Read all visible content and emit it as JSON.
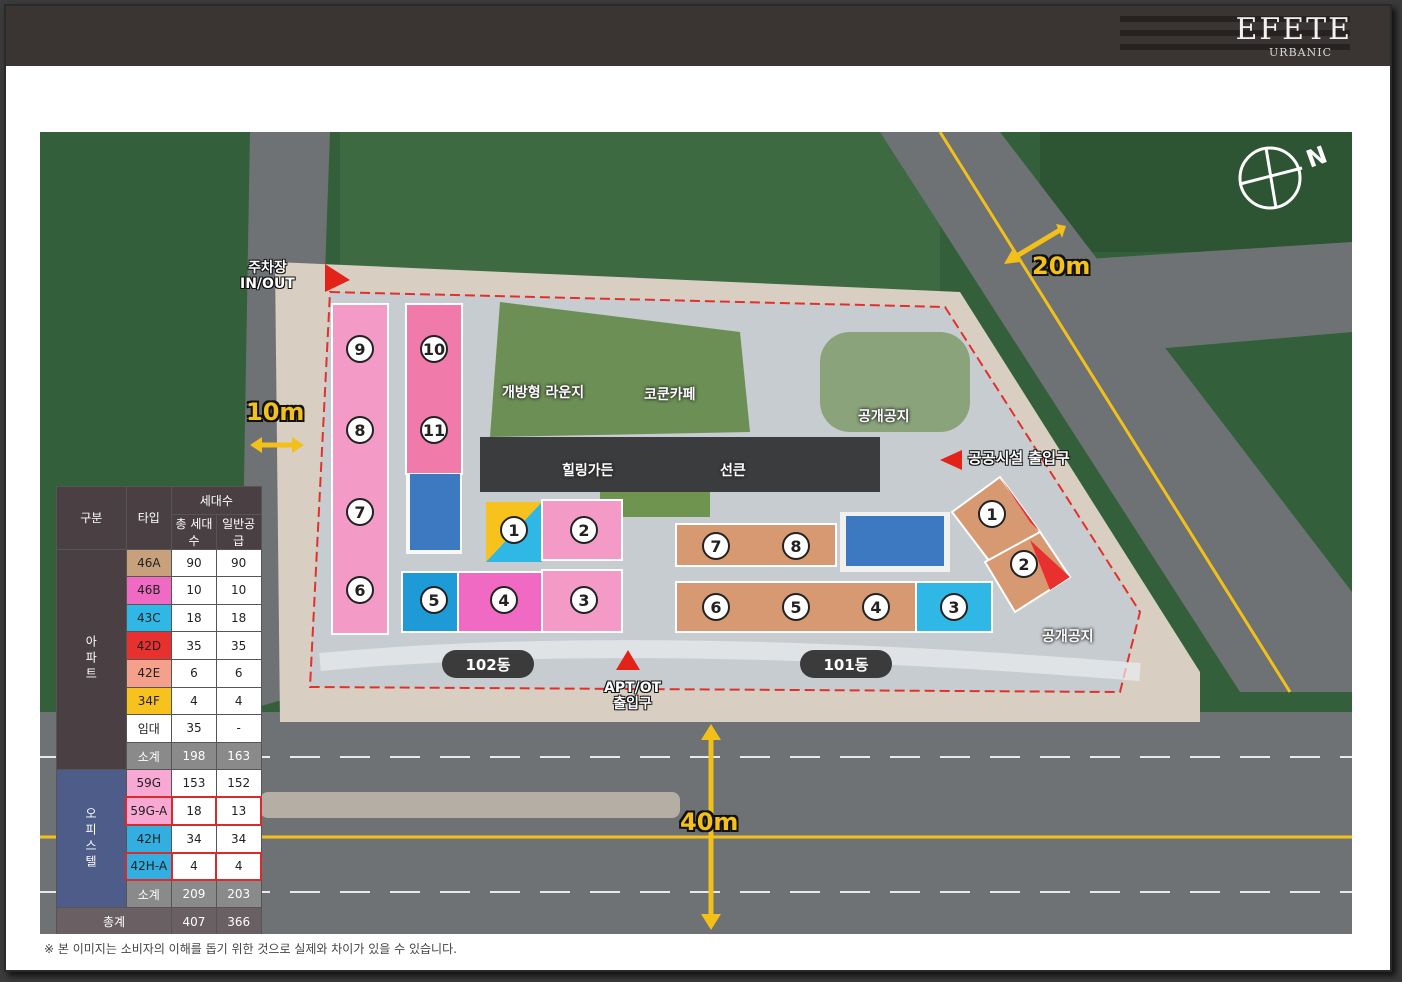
{
  "header": {
    "logo_main": "EFETE",
    "logo_sub": "URBANIC"
  },
  "map": {
    "labels": {
      "parking_line1": "주차장",
      "parking_line2": "IN/OUT",
      "lounge": "개방형 라운지",
      "cafe": "코쿤카페",
      "public_space_top": "공개공지",
      "healing_garden": "힐링가든",
      "sunken": "선큰",
      "public_facility_entrance": "공공시설 출입구",
      "public_space_right": "공개공지",
      "apt_entrance_line1": "APT/OT",
      "apt_entrance_line2": "출입구"
    },
    "distances": {
      "road_top": "20m",
      "road_left": "10m",
      "road_main": "40m"
    },
    "buildings": {
      "dong_102": "102동",
      "dong_101": "101동"
    },
    "units_102": [
      "9",
      "10",
      "8",
      "11",
      "7",
      "6",
      "5",
      "4",
      "3",
      "1",
      "2"
    ],
    "units_101": [
      "7",
      "8",
      "6",
      "5",
      "4",
      "3",
      "1",
      "2"
    ]
  },
  "table": {
    "headers": {
      "category": "구분",
      "type": "타입",
      "households": "세대수",
      "total": "총 세대수",
      "general": "일반공급"
    },
    "apt_label": "아파트",
    "office_label": "오피스텔",
    "apt_rows": [
      {
        "type": "46A",
        "total": "90",
        "general": "90",
        "color": "#c8a07c"
      },
      {
        "type": "46B",
        "total": "10",
        "general": "10",
        "color": "#f06ac4"
      },
      {
        "type": "43C",
        "total": "18",
        "general": "18",
        "color": "#2fb8e6"
      },
      {
        "type": "42D",
        "total": "35",
        "general": "35",
        "color": "#e8302f"
      },
      {
        "type": "42E",
        "total": "6",
        "general": "6",
        "color": "#f5a08a"
      },
      {
        "type": "34F",
        "total": "4",
        "general": "4",
        "color": "#f7c21e"
      },
      {
        "type": "임대",
        "total": "35",
        "general": "-",
        "color": "#ffffff"
      }
    ],
    "apt_subtotal": {
      "label": "소계",
      "total": "198",
      "general": "163"
    },
    "office_rows": [
      {
        "type": "59G",
        "total": "153",
        "general": "152",
        "color": "#f7a9d3"
      },
      {
        "type": "59G-A",
        "total": "18",
        "general": "13",
        "color": "#f7a9d3"
      },
      {
        "type": "42H",
        "total": "34",
        "general": "34",
        "color": "#33aee0"
      },
      {
        "type": "42H-A",
        "total": "4",
        "general": "4",
        "color": "#33aee0"
      }
    ],
    "office_subtotal": {
      "label": "소계",
      "total": "209",
      "general": "203"
    },
    "grand_total": {
      "label": "총계",
      "total": "407",
      "general": "366"
    }
  },
  "disclaimer": "※ 본 이미지는 소비자의 이해를 돕기 위한 것으로 실제와 차이가 있을 수 있습니다."
}
